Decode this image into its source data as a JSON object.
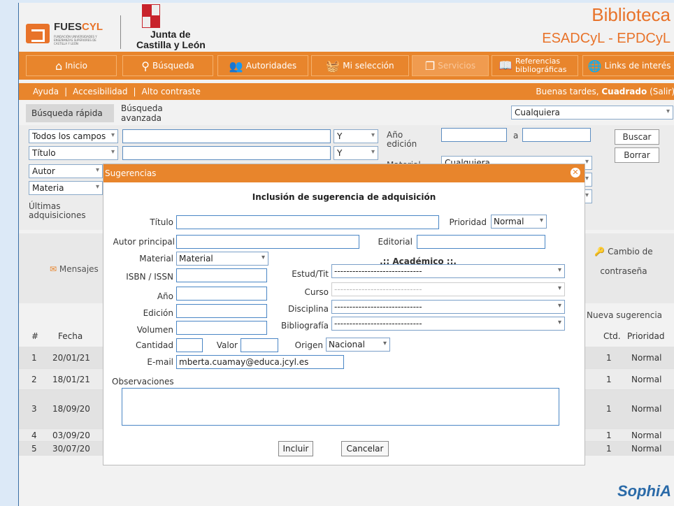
{
  "header": {
    "fues_title_a": "FUES",
    "fues_title_b": "CYL",
    "fues_sub": "FUNDACIÓN UNIVERSIDADES Y ENSEÑANZAS SUPERIORES DE CASTILLA Y LEÓN",
    "jcyl_line1": "Junta de",
    "jcyl_line2": "Castilla y León",
    "title": "Biblioteca",
    "subtitle": "ESADCyL - EPDCyL"
  },
  "nav": {
    "inicio": "Inicio",
    "busqueda": "Búsqueda",
    "autoridades": "Autoridades",
    "seleccion": "Mi selección",
    "servicios": "Servicios",
    "referencias": "Referencias bibliográficas",
    "links": "Links de interés"
  },
  "subbar": {
    "ayuda": "Ayuda",
    "accesibilidad": "Accesibilidad",
    "contraste": "Alto contraste",
    "greet_prefix": "Buenas tardes, ",
    "user": "Cuadrado",
    "salir": "(Salir)"
  },
  "tabs": {
    "rapida": "Búsqueda rápida",
    "avanzada": "Búsqueda avanzada",
    "scope": "Cualquiera"
  },
  "search": {
    "field1": "Todos los campos",
    "field2": "Título",
    "field3": "Autor",
    "field4": "Materia",
    "op1": "Y",
    "op2": "Y",
    "anio_label": "Año edición",
    "a_label": "a",
    "material_label": "Material",
    "material_value": "Cualquiera",
    "ultimas": "Últimas adquisiciones",
    "buscar": "Buscar",
    "borrar": "Borrar"
  },
  "panel": {
    "mensajes": "Mensajes",
    "cambio": "Cambio de contraseña"
  },
  "table": {
    "nueva": "Nueva sugerencia",
    "headers": {
      "num": "#",
      "fecha": "Fecha",
      "ctd": "Ctd.",
      "prioridad": "Prioridad"
    },
    "rows": [
      {
        "num": "1",
        "fecha": "20/01/21",
        "ctd": "1",
        "prioridad": "Normal"
      },
      {
        "num": "2",
        "fecha": "18/01/21",
        "ctd": "1",
        "prioridad": "Normal"
      },
      {
        "num": "3",
        "fecha": "18/09/20",
        "ctd": "1",
        "prioridad": "Normal"
      },
      {
        "num": "4",
        "fecha": "03/09/20",
        "ctd": "1",
        "prioridad": "Normal"
      },
      {
        "num": "5",
        "fecha": "30/07/20",
        "ctd": "1",
        "prioridad": "Normal"
      }
    ]
  },
  "modal": {
    "header": "Sugerencias",
    "title": "Inclusión de sugerencia de adquisición",
    "titulo": "Título",
    "prioridad": "Prioridad",
    "prioridad_value": "Normal",
    "autor": "Autor principal",
    "editorial": "Editorial",
    "material": "Material",
    "material_value": "Material",
    "academico": ".:: Académico ::.",
    "isbn": "ISBN / ISSN",
    "estud": "Estud/Tit",
    "anio": "Año",
    "curso": "Curso",
    "edicion": "Edición",
    "disciplina": "Disciplina",
    "volumen": "Volumen",
    "bibliografia": "Bibliografía",
    "dashes": "-----------------------------",
    "cantidad": "Cantidad",
    "valor": "Valor",
    "origen": "Origen",
    "origen_value": "Nacional",
    "email": "E-mail",
    "email_value": "mberta.cuamay@educa.jcyl.es",
    "observaciones": "Observaciones",
    "incluir": "Incluir",
    "cancelar": "Cancelar"
  },
  "footer": {
    "logo": "SophiA"
  }
}
